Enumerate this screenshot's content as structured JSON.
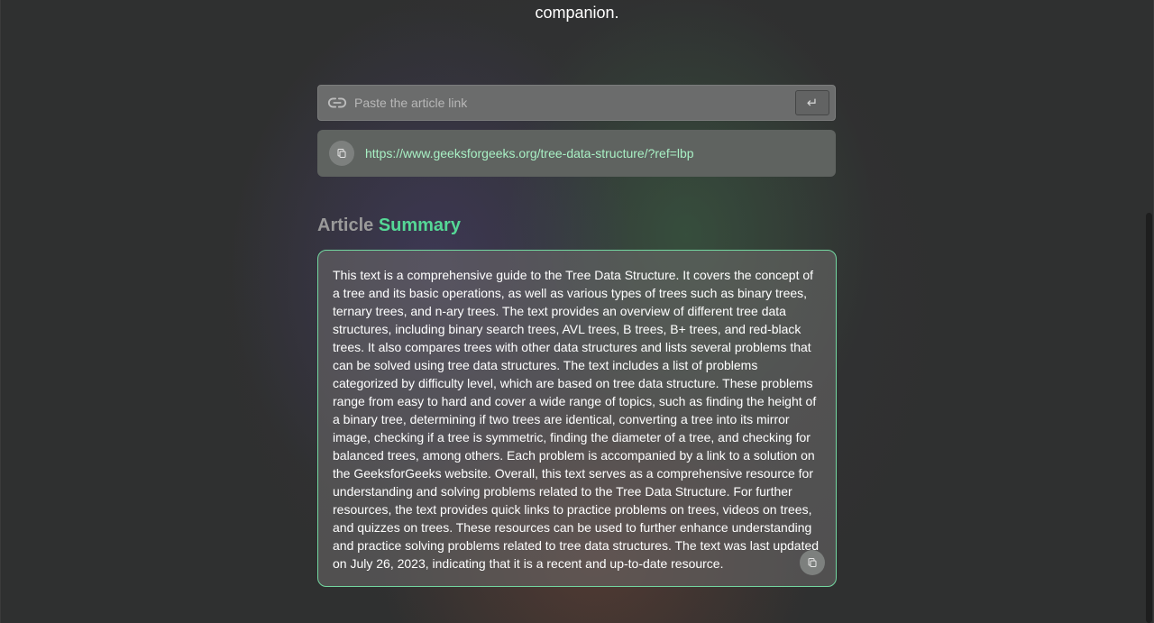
{
  "header": {
    "tagline": "companion."
  },
  "link_input": {
    "placeholder": "Paste the article link",
    "value": "",
    "submit_glyph": "↵",
    "icon": "link-icon"
  },
  "history": [
    {
      "url": "https://www.geeksforgeeks.org/tree-data-structure/?ref=lbp",
      "icon": "copy-icon"
    }
  ],
  "summary": {
    "title_part1": "Article",
    "title_part2": "Summary",
    "text": "This text is a comprehensive guide to the Tree Data Structure. It covers the concept of a tree and its basic operations, as well as various types of trees such as binary trees, ternary trees, and n-ary trees. The text provides an overview of different tree data structures, including binary search trees, AVL trees, B trees, B+ trees, and red-black trees. It also compares trees with other data structures and lists several problems that can be solved using tree data structures. The text includes a list of problems categorized by difficulty level, which are based on tree data structure. These problems range from easy to hard and cover a wide range of topics, such as finding the height of a binary tree, determining if two trees are identical, converting a tree into its mirror image, checking if a tree is symmetric, finding the diameter of a tree, and checking for balanced trees, among others. Each problem is accompanied by a link to a solution on the GeeksforGeeks website. Overall, this text serves as a comprehensive resource for understanding and solving problems related to the Tree Data Structure. For further resources, the text provides quick links to practice problems on trees, videos on trees, and quizzes on trees. These resources can be used to further enhance understanding and practice solving problems related to tree data structures. The text was last updated on July 26, 2023, indicating that it is a recent and up-to-date resource.",
    "copy_icon": "copy-icon"
  },
  "colors": {
    "accent_green": "#55d896",
    "url_green": "#a8f0c4",
    "summary_border": "#73d7a0",
    "background": "#2f3030"
  }
}
